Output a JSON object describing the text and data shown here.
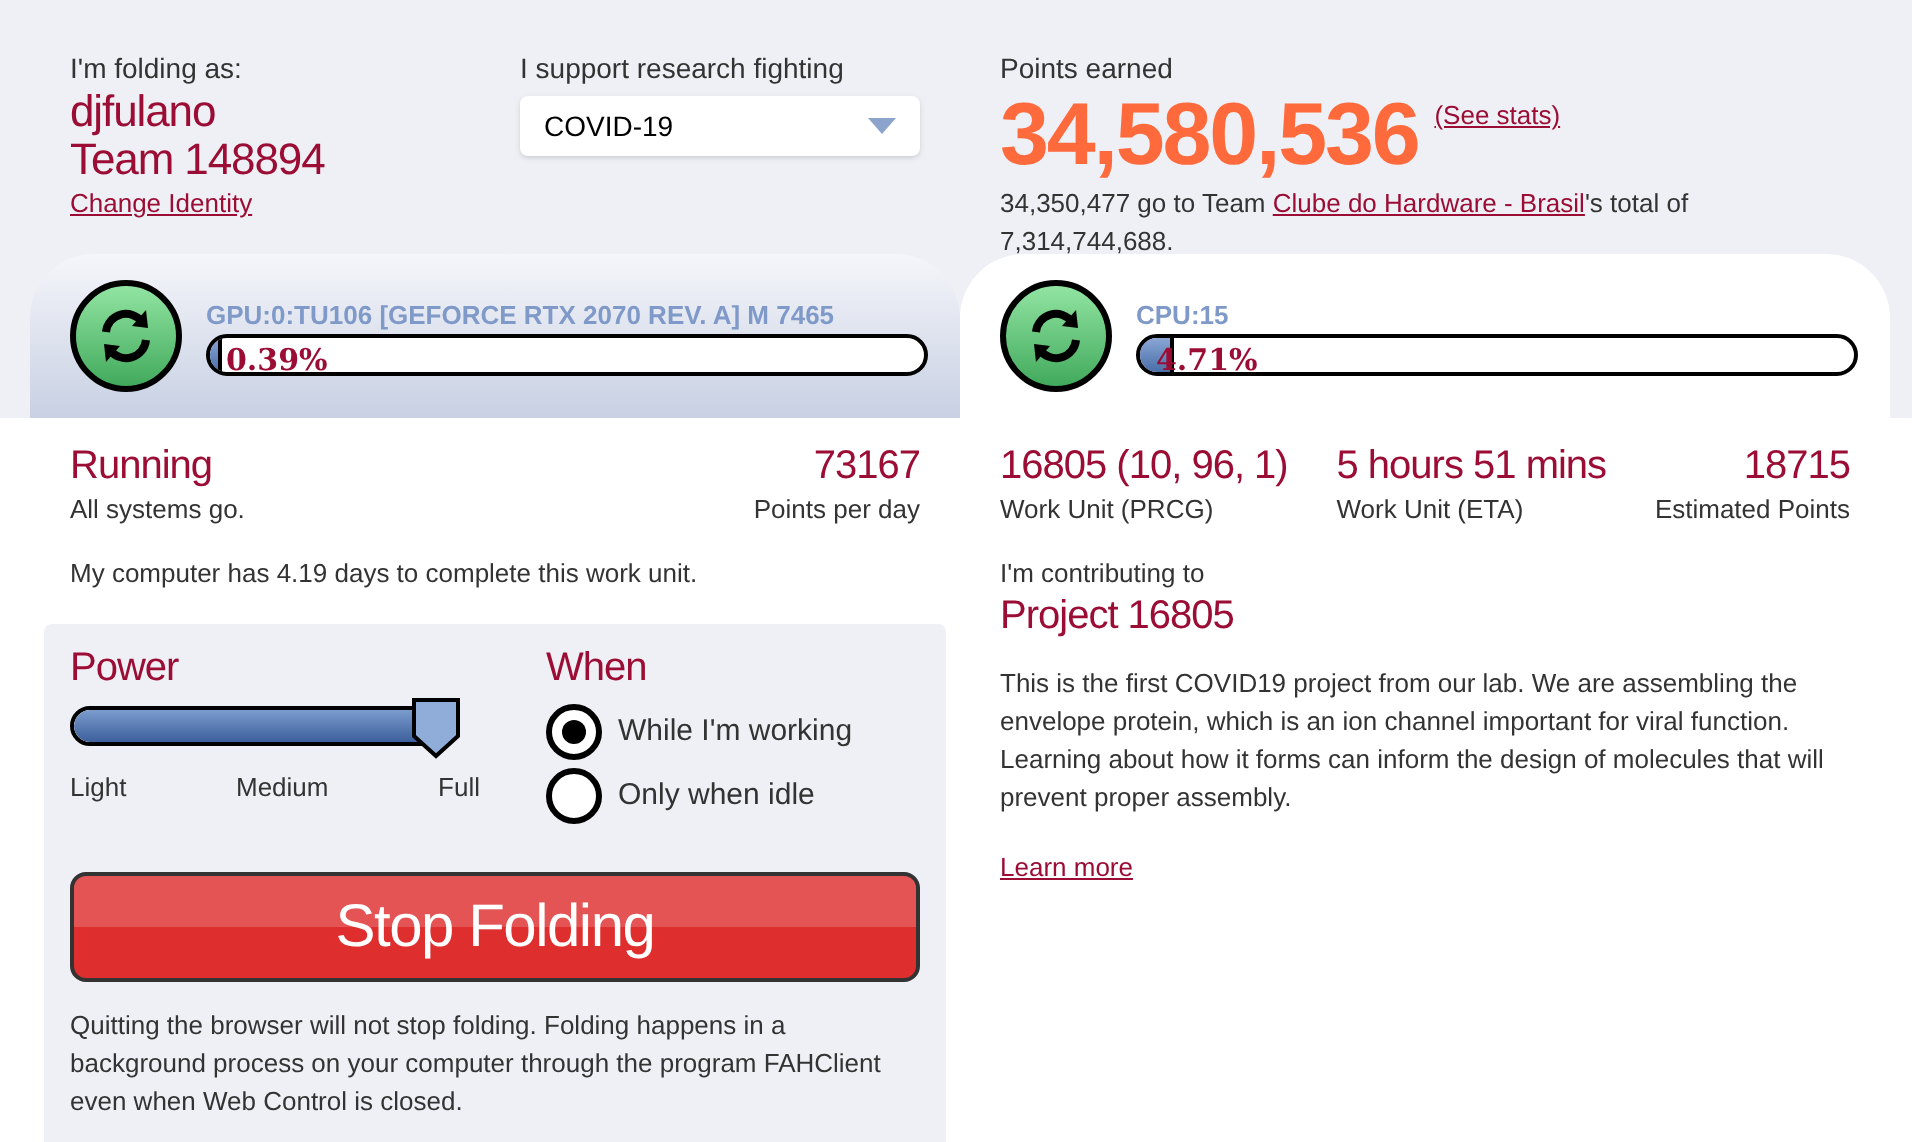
{
  "identity": {
    "label": "I'm folding as:",
    "user": "djfulano",
    "team": "Team 148894",
    "change_link": "Change Identity"
  },
  "cause": {
    "label": "I support research fighting",
    "value": "COVID-19"
  },
  "points": {
    "label": "Points earned",
    "total": "34,580,536",
    "stats_link": "(See stats)",
    "team_pre": "34,350,477 go to Team ",
    "team_link": "Clube do Hardware - Brasil",
    "team_post": "'s total of 7,314,744,688."
  },
  "slots": [
    {
      "name": "GPU:0:TU106 [GEFORCE RTX 2070 REV. A] M 7465",
      "progress": "0.39%",
      "level": 0.0039,
      "selected": false
    },
    {
      "name": "CPU:15",
      "progress": "4.71%",
      "level": 0.0471,
      "selected": true
    }
  ],
  "status": {
    "state": "Running",
    "message": "All systems go.",
    "ppd": "73167",
    "ppd_label": "Points per day",
    "eta_note": "My computer has 4.19 days to complete this work unit."
  },
  "power": {
    "title": "Power",
    "level": 1,
    "labels": [
      "Light",
      "Medium",
      "Full"
    ]
  },
  "when": {
    "title": "When",
    "options": [
      {
        "label": "While I'm working",
        "selected": true
      },
      {
        "label": "Only when idle",
        "selected": false
      }
    ]
  },
  "stop_button": "Stop Folding",
  "footnote": "Quitting the browser will not stop folding. Folding happens in a background process on your computer through the program FAHClient even when Web Control is closed.",
  "work_unit": {
    "stats": [
      {
        "value": "16805 (10, 96, 1)",
        "label": "Work Unit (PRCG)"
      },
      {
        "value": "5 hours 51 mins",
        "label": "Work Unit (ETA)"
      },
      {
        "value": "18715",
        "label": "Estimated Points"
      }
    ],
    "contrib_label": "I'm contributing to",
    "project": "Project 16805",
    "description": "This is the first COVID19 project from our lab. We are assembling the envelope protein, which is an ion channel important for viral function. Learning about how it forms can inform the design of molecules that will prevent proper assembly.",
    "learn_more": "Learn more"
  }
}
